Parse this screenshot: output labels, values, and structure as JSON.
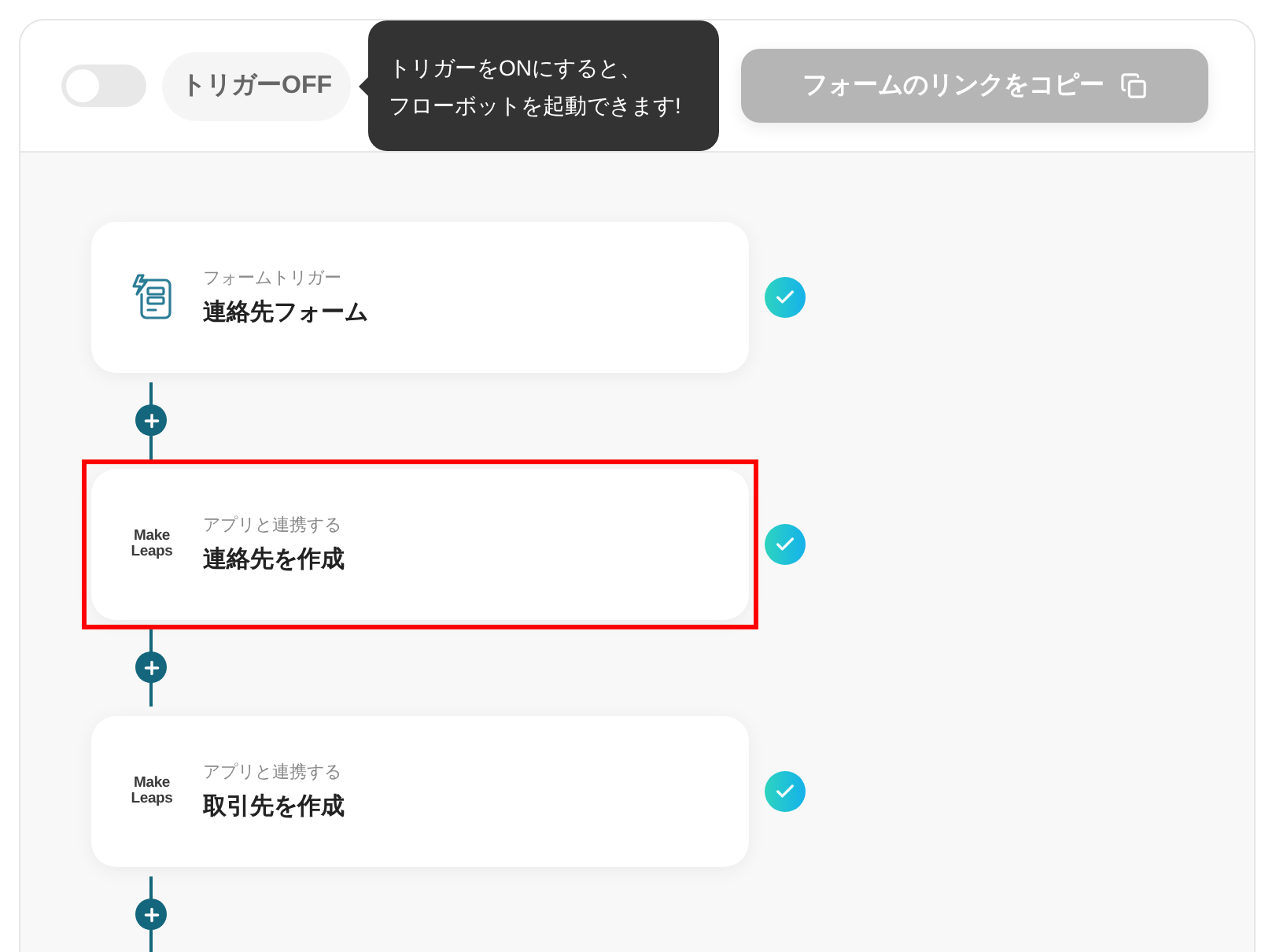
{
  "trigger_toggle": {
    "on": false
  },
  "trigger_status": "トリガーOFF",
  "tooltip": {
    "lines": [
      "トリガーをONにすると、",
      "フローボットを起動できます!"
    ]
  },
  "copy_link_button": {
    "label": "フォームのリンクをコピー",
    "disabled": true
  },
  "steps": [
    {
      "kind": "form",
      "category": "フォームトリガー",
      "title": "連絡先フォーム",
      "completed": true,
      "highlighted": false
    },
    {
      "kind": "app",
      "logo": "Make\nLeaps",
      "category": "アプリと連携する",
      "title": "連絡先を作成",
      "completed": true,
      "highlighted": true
    },
    {
      "kind": "app",
      "logo": "Make\nLeaps",
      "category": "アプリと連携する",
      "title": "取引先を作成",
      "completed": true,
      "highlighted": false
    }
  ]
}
